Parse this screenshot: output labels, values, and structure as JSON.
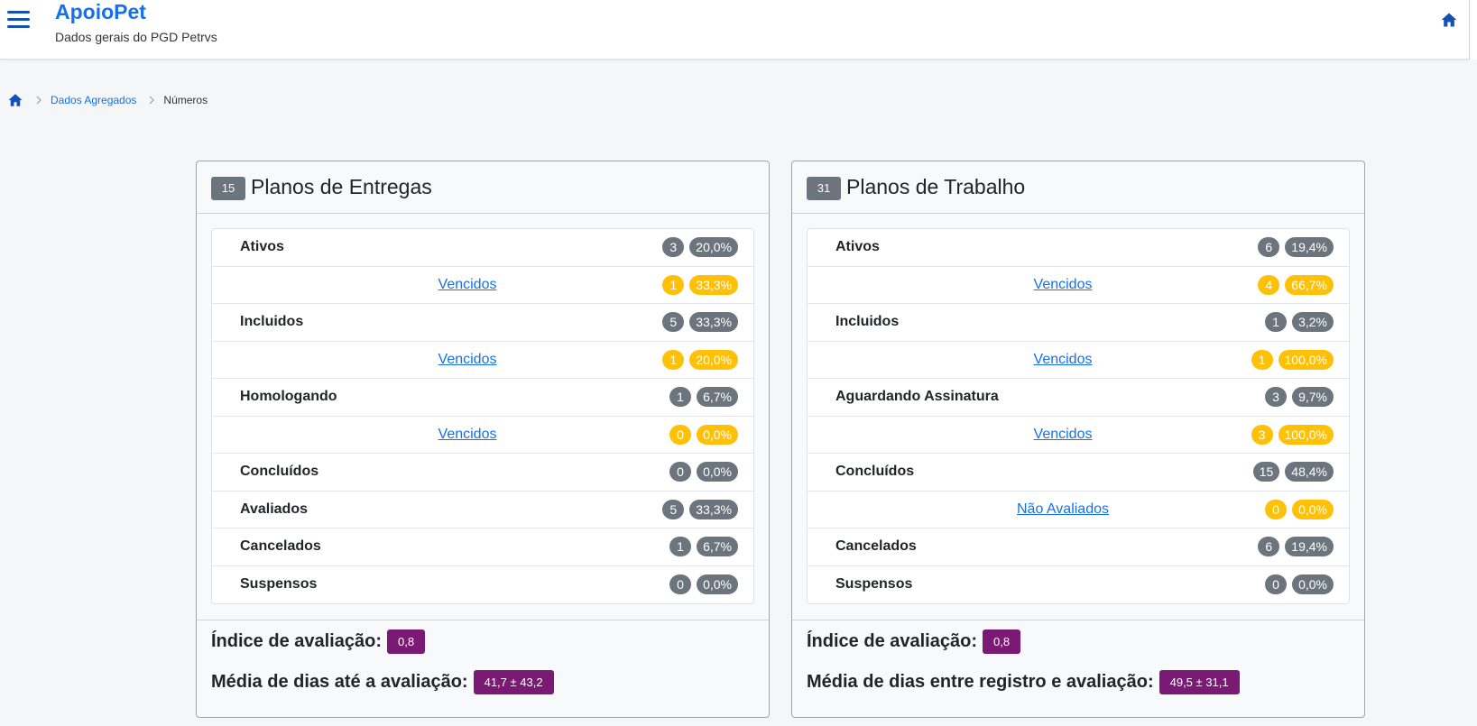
{
  "header": {
    "app_title": "ApoioPet",
    "app_subtitle": "Dados gerais do PGD Petrvs",
    "menu_icon": "hamburger-menu-icon",
    "home_icon": "home-icon"
  },
  "breadcrumb": {
    "items": [
      "Dados Agregados",
      "Números"
    ]
  },
  "colors": {
    "brand": "#1670ee",
    "badge_gray": "#6c757d",
    "badge_yellow": "#ffc107",
    "metric_purple": "#7b1a74"
  },
  "left_card": {
    "count": "15",
    "title": "Planos de Entregas",
    "rows": [
      {
        "label": "Ativos",
        "count": "3",
        "pct": "20,0%"
      },
      {
        "link": "Vencidos",
        "count": "1",
        "pct": "33,3%"
      },
      {
        "label": "Incluidos",
        "count": "5",
        "pct": "33,3%"
      },
      {
        "link": "Vencidos",
        "count": "1",
        "pct": "20,0%"
      },
      {
        "label": "Homologando",
        "count": "1",
        "pct": "6,7%"
      },
      {
        "link": "Vencidos",
        "count": "0",
        "pct": "0,0%"
      },
      {
        "label": "Concluídos",
        "count": "0",
        "pct": "0,0%"
      },
      {
        "label": "Avaliados",
        "count": "5",
        "pct": "33,3%"
      },
      {
        "label": "Cancelados",
        "count": "1",
        "pct": "6,7%"
      },
      {
        "label": "Suspensos",
        "count": "0",
        "pct": "0,0%"
      }
    ],
    "metric1_label": "Índice de avaliação:",
    "metric1_value": "0,8",
    "metric2_label": "Média de dias até a avaliação:",
    "metric2_value": "41,7 ± 43,2"
  },
  "right_card": {
    "count": "31",
    "title": "Planos de Trabalho",
    "rows": [
      {
        "label": "Ativos",
        "count": "6",
        "pct": "19,4%"
      },
      {
        "link": "Vencidos",
        "count": "4",
        "pct": "66,7%"
      },
      {
        "label": "Incluidos",
        "count": "1",
        "pct": "3,2%"
      },
      {
        "link": "Vencidos",
        "count": "1",
        "pct": "100,0%"
      },
      {
        "label": "Aguardando Assinatura",
        "count": "3",
        "pct": "9,7%"
      },
      {
        "link": "Vencidos",
        "count": "3",
        "pct": "100,0%"
      },
      {
        "label": "Concluídos",
        "count": "15",
        "pct": "48,4%"
      },
      {
        "link": "Não Avaliados",
        "count": "0",
        "pct": "0,0%"
      },
      {
        "label": "Cancelados",
        "count": "6",
        "pct": "19,4%"
      },
      {
        "label": "Suspensos",
        "count": "0",
        "pct": "0,0%"
      }
    ],
    "metric1_label": "Índice de avaliação:",
    "metric1_value": "0,8",
    "metric2_label": "Média de dias entre registro e avaliação:",
    "metric2_value": "49,5 ± 31,1"
  }
}
